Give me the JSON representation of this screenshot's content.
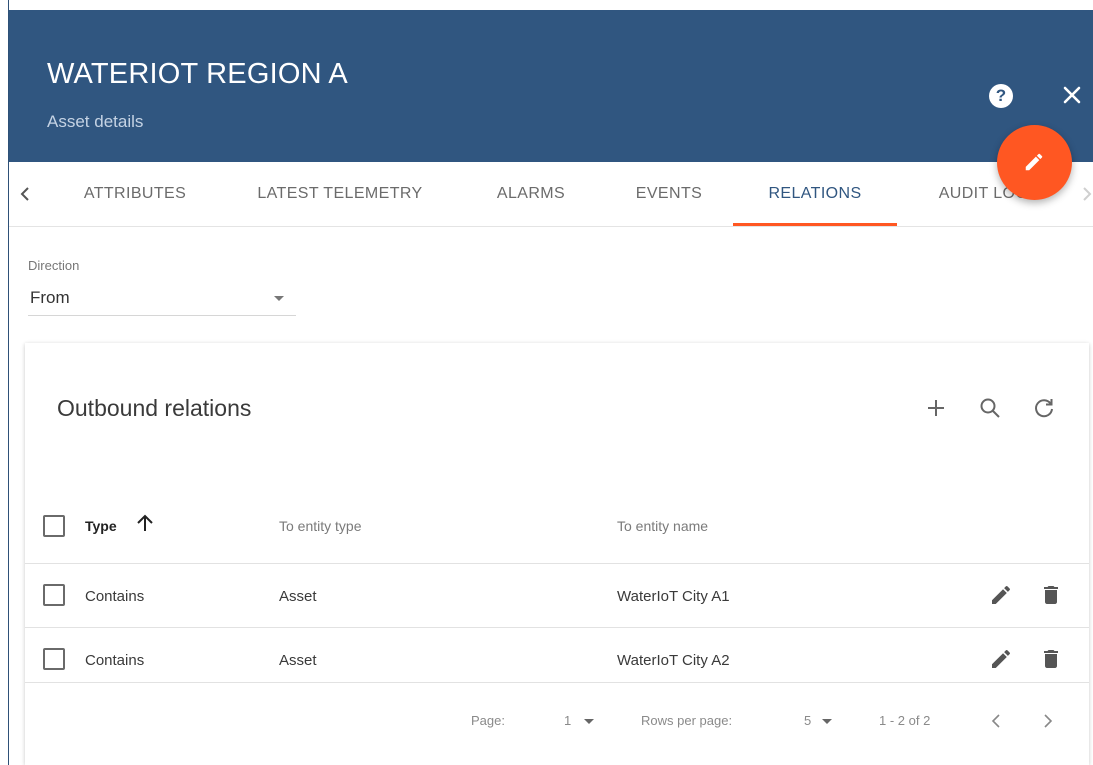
{
  "header": {
    "title": "WATERIOT REGION A",
    "subtitle": "Asset details",
    "help_symbol": "?"
  },
  "tabs": [
    {
      "label": "ATTRIBUTES"
    },
    {
      "label": "LATEST TELEMETRY"
    },
    {
      "label": "ALARMS"
    },
    {
      "label": "EVENTS"
    },
    {
      "label": "RELATIONS",
      "active": true
    },
    {
      "label": "AUDIT LOGS"
    }
  ],
  "direction": {
    "label": "Direction",
    "value": "From"
  },
  "relations": {
    "title": "Outbound relations",
    "columns": {
      "type": "Type",
      "to_entity_type": "To entity type",
      "to_entity_name": "To entity name"
    },
    "rows": [
      {
        "type": "Contains",
        "entity_type": "Asset",
        "entity_name": "WaterIoT City A1"
      },
      {
        "type": "Contains",
        "entity_type": "Asset",
        "entity_name": "WaterIoT City A2"
      }
    ]
  },
  "pagination": {
    "page_label": "Page:",
    "page_value": "1",
    "rows_label": "Rows per page:",
    "rows_value": "5",
    "range": "1 - 2 of 2"
  },
  "colors": {
    "header_bg": "#305680",
    "accent": "#ff5722",
    "active_tab": "#305680"
  },
  "icons": [
    "help-icon",
    "close-icon",
    "pencil-icon",
    "chevron-left-icon",
    "chevron-right-icon",
    "dropdown-caret-icon",
    "plus-icon",
    "search-icon",
    "refresh-icon",
    "arrow-up-icon",
    "delete-icon"
  ]
}
